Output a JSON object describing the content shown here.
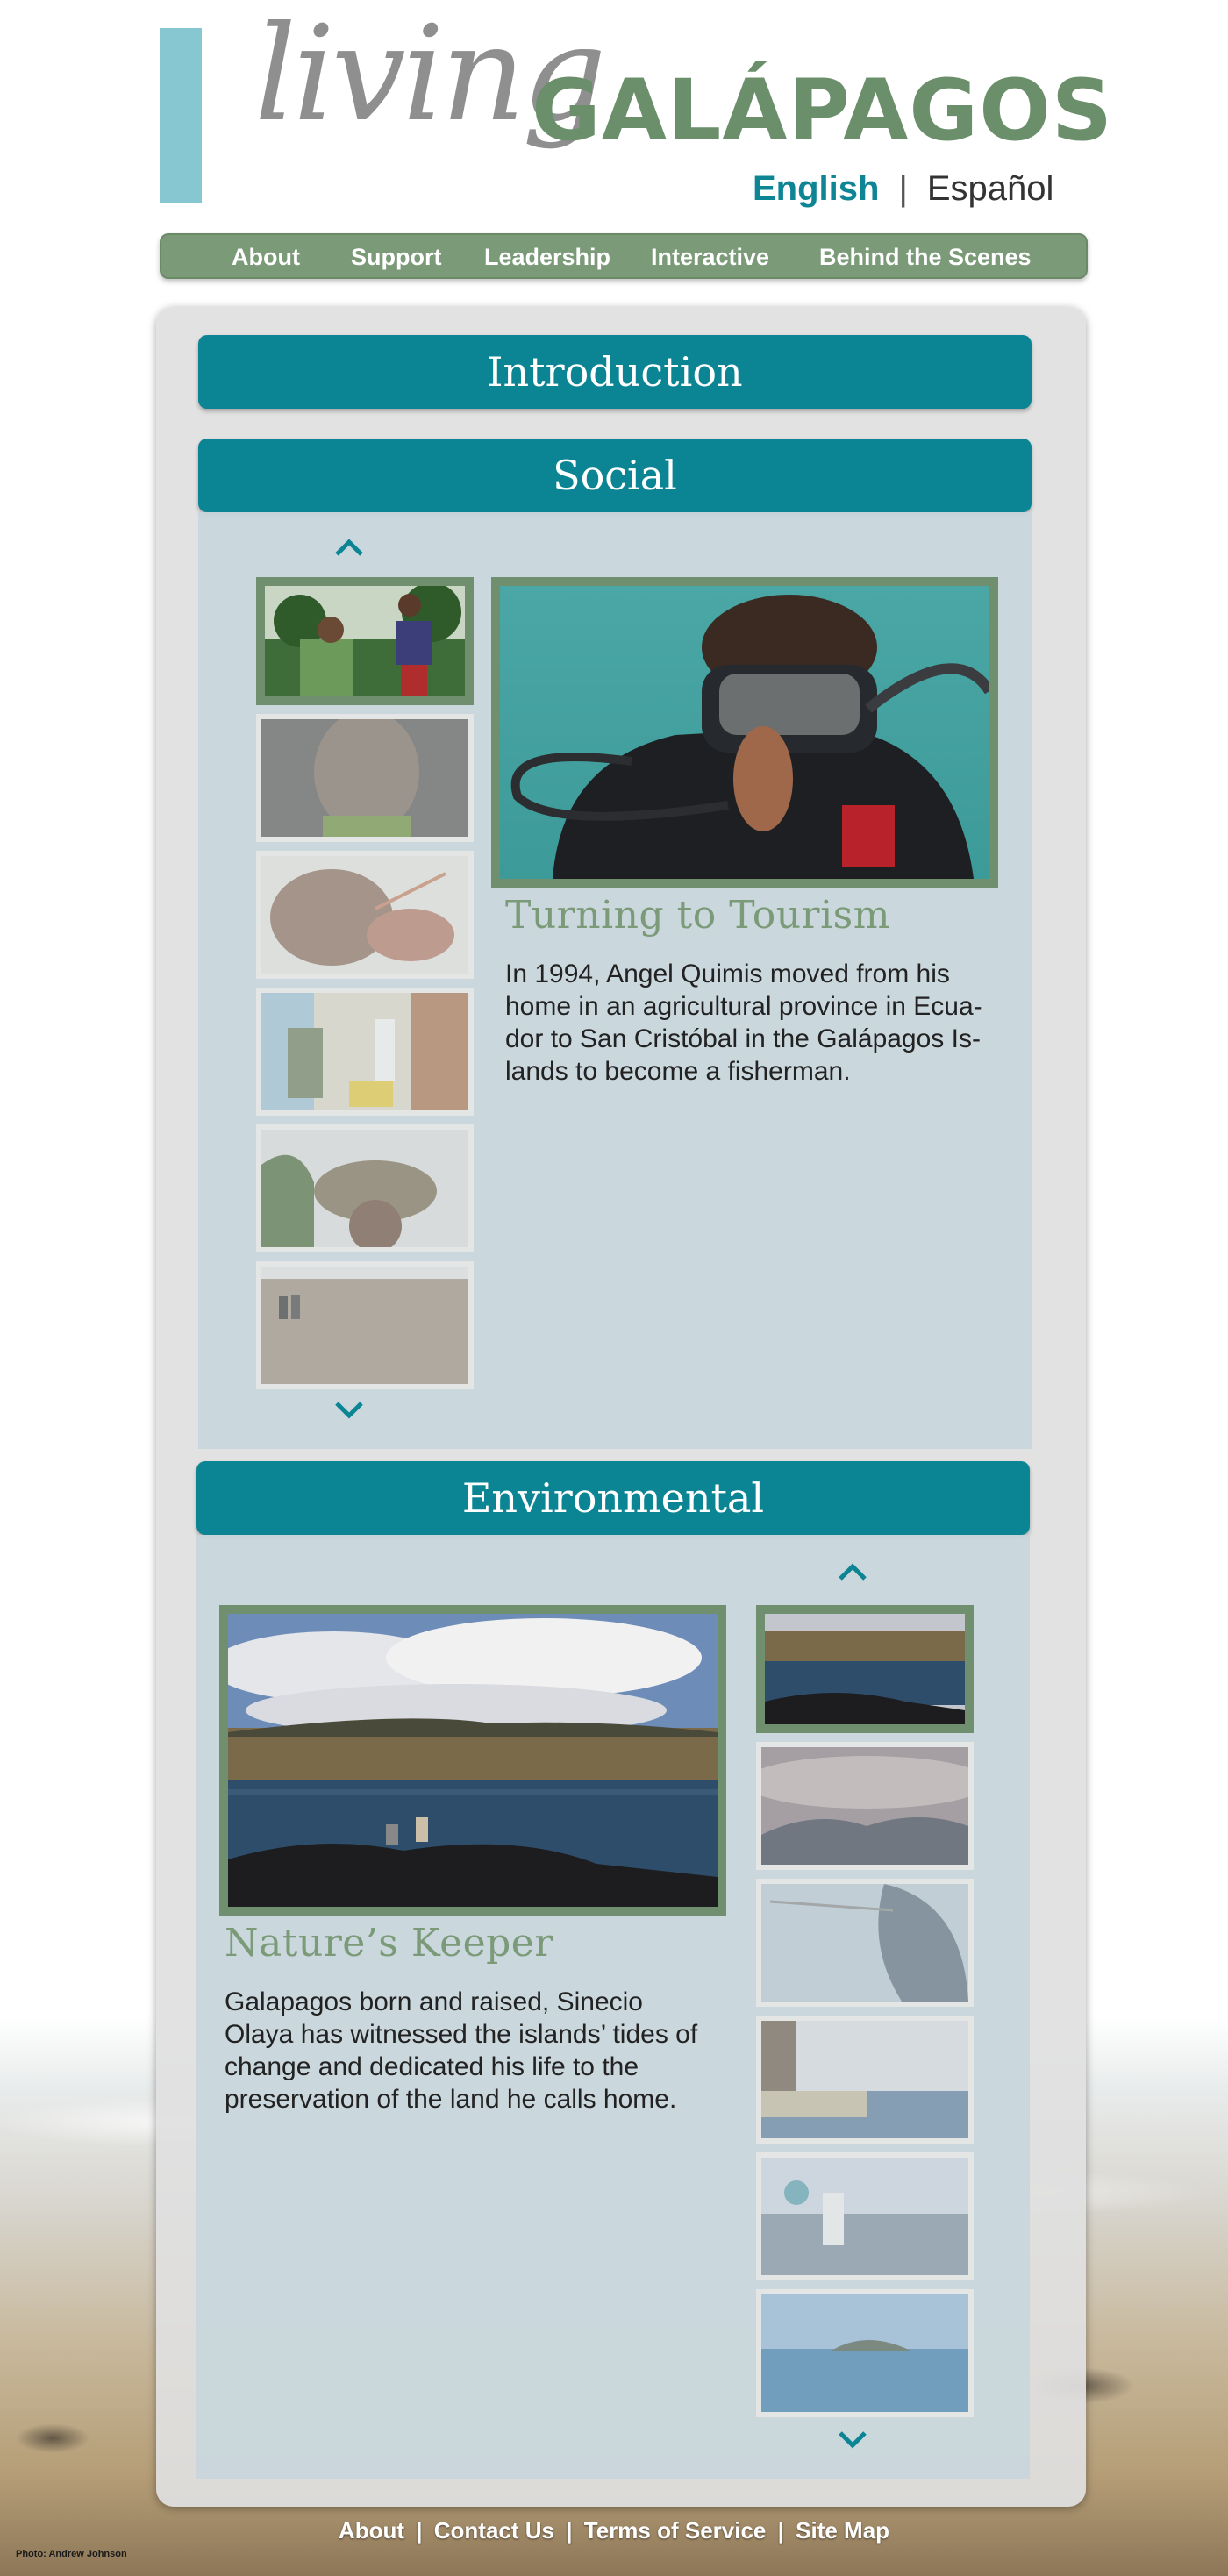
{
  "header": {
    "logo_living": "living",
    "logo_galapagos": "GALÁPAGOS",
    "lang_english": "English",
    "lang_separator": "|",
    "lang_spanish": "Español"
  },
  "nav": {
    "items": [
      "About",
      "Support",
      "Leadership",
      "Interactive",
      "Behind the Scenes"
    ]
  },
  "sections": {
    "introduction": {
      "title": "Introduction"
    },
    "social": {
      "title": "Social",
      "story_title": "Turning to Tourism",
      "story_lines": [
        "In 1994, Angel Quimis moved from his",
        "home in an agricultural province in Ecua-",
        "dor to San Cristóbal in the Galápagos Is-",
        "lands to become a fisherman."
      ]
    },
    "environmental": {
      "title": "Environmental",
      "story_title": "Nature’s Keeper",
      "story_lines": [
        "Galapagos born and raised, Sinecio",
        "Olaya has witnessed the islands’ tides of",
        "change and dedicated his life to the",
        "preservation of the land he calls home."
      ]
    }
  },
  "footer": {
    "about": "About",
    "contact": "Contact Us",
    "terms": "Terms of Service",
    "sitemap": "Site Map",
    "separator": "|",
    "photo_credit": "Photo: Andrew Johnson"
  },
  "colors": {
    "teal": "#0b8494",
    "sage": "#6f8f6f",
    "logo_bar": "#87c7d1"
  }
}
